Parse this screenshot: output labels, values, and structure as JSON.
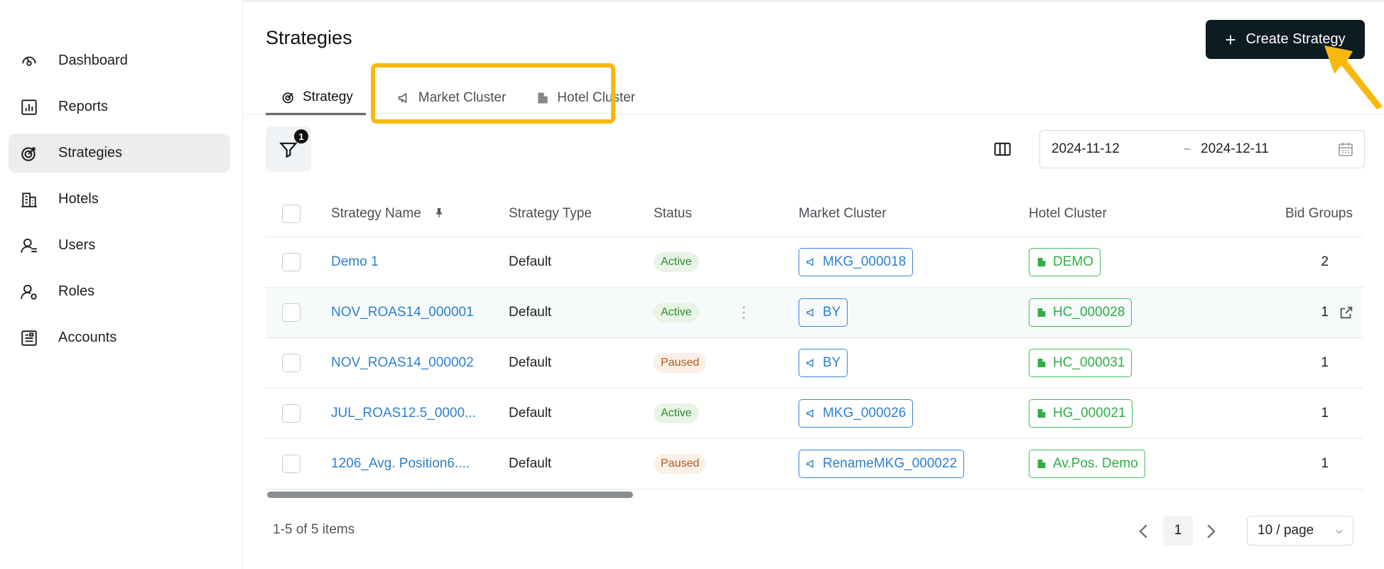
{
  "sidebar": {
    "items": [
      {
        "label": "Dashboard",
        "icon": "dashboard-icon"
      },
      {
        "label": "Reports",
        "icon": "reports-icon"
      },
      {
        "label": "Strategies",
        "icon": "strategies-icon",
        "active": true
      },
      {
        "label": "Hotels",
        "icon": "hotels-icon"
      },
      {
        "label": "Users",
        "icon": "users-icon"
      },
      {
        "label": "Roles",
        "icon": "roles-icon"
      },
      {
        "label": "Accounts",
        "icon": "accounts-icon"
      }
    ]
  },
  "header": {
    "title": "Strategies",
    "create_label": "Create Strategy"
  },
  "tabs": [
    {
      "label": "Strategy",
      "icon": "target-icon"
    },
    {
      "label": "Market Cluster",
      "icon": "megaphone-icon"
    },
    {
      "label": "Hotel Cluster",
      "icon": "building-icon"
    }
  ],
  "toolbar": {
    "filter_count": "1",
    "date_start": "2024-11-12",
    "date_separator": "~",
    "date_end": "2024-12-11"
  },
  "table": {
    "columns": [
      "Strategy Name",
      "Strategy Type",
      "Status",
      "Market Cluster",
      "Hotel Cluster",
      "Bid Groups"
    ],
    "rows": [
      {
        "name": "Demo 1",
        "type": "Default",
        "status": "Active",
        "market_cluster": "MKG_000018",
        "hotel_cluster": "DEMO",
        "bid_groups": "2"
      },
      {
        "name": "NOV_ROAS14_000001",
        "type": "Default",
        "status": "Active",
        "market_cluster": "BY",
        "hotel_cluster": "HC_000028",
        "bid_groups": "1"
      },
      {
        "name": "NOV_ROAS14_000002",
        "type": "Default",
        "status": "Paused",
        "market_cluster": "BY",
        "hotel_cluster": "HC_000031",
        "bid_groups": "1"
      },
      {
        "name": "JUL_ROAS12.5_0000...",
        "type": "Default",
        "status": "Active",
        "market_cluster": "MKG_000026",
        "hotel_cluster": "HG_000021",
        "bid_groups": "1"
      },
      {
        "name": "1206_Avg. Position6....",
        "type": "Default",
        "status": "Paused",
        "market_cluster": "RenameMKG_000022",
        "hotel_cluster": "Av.Pos. Demo",
        "bid_groups": "1"
      }
    ]
  },
  "pagination": {
    "info": "1-5 of 5 items",
    "current_page": "1",
    "page_size": "10 / page"
  },
  "colors": {
    "accent": "#0d1b22",
    "highlight": "#f8b90c",
    "link": "#2e7fcf",
    "hotel_tag": "#2fae45"
  }
}
